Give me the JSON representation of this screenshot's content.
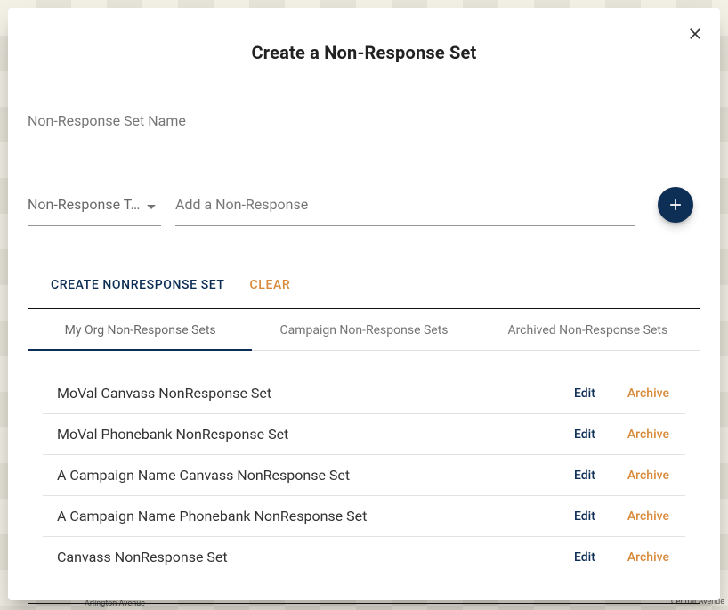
{
  "modal": {
    "title": "Create a Non-Response Set",
    "nameField": {
      "placeholder": "Non-Response Set Name"
    },
    "typeSelect": {
      "label": "Non-Response T…"
    },
    "addField": {
      "placeholder": "Add a Non-Response"
    },
    "createBtn": "CREATE NONRESPONSE SET",
    "clearBtn": "CLEAR"
  },
  "tabs": {
    "my_org": "My Org Non-Response Sets",
    "campaign": "Campaign Non-Response Sets",
    "archived": "Archived Non-Response Sets",
    "active": "my_org"
  },
  "rowActions": {
    "edit": "Edit",
    "archive": "Archive"
  },
  "sets": {
    "0": {
      "name": "MoVal Canvass NonResponse Set"
    },
    "1": {
      "name": "MoVal Phonebank NonResponse Set"
    },
    "2": {
      "name": "A Campaign Name Canvass NonResponse Set"
    },
    "3": {
      "name": "A Campaign Name Phonebank NonResponse Set"
    },
    "4": {
      "name": "Canvass NonResponse Set"
    }
  },
  "map": {
    "labels": {
      "arlington": "Arlington Avenue",
      "central": "Central Avenue"
    }
  },
  "colors": {
    "brand": "#0d2f56",
    "accent": "#d88a3a"
  }
}
